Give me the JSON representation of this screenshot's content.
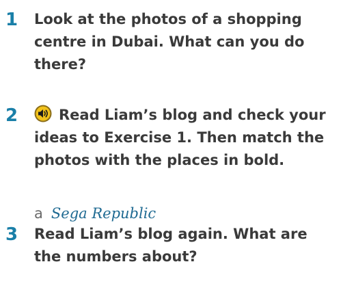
{
  "colors": {
    "exercise_number": "#1a7fa8",
    "instruction_text": "#3a3a3a",
    "answer_text": "#1f6a92",
    "audio_icon_outer": "#8a6d1a",
    "audio_icon_inner": "#f2c21b"
  },
  "exercises": [
    {
      "number": "1",
      "instruction": "Look at the photos of a shopping centre in Dubai. What can you do there?"
    },
    {
      "number": "2",
      "icon": "audio-speaker-icon",
      "instruction": "Read Liam’s blog and check your ideas to Exercise 1. Then match the photos with the places in bold.",
      "example": {
        "letter": "a",
        "answer": "Sega Republic"
      }
    },
    {
      "number": "3",
      "instruction": "Read Liam’s blog again. What are the numbers about?"
    }
  ]
}
